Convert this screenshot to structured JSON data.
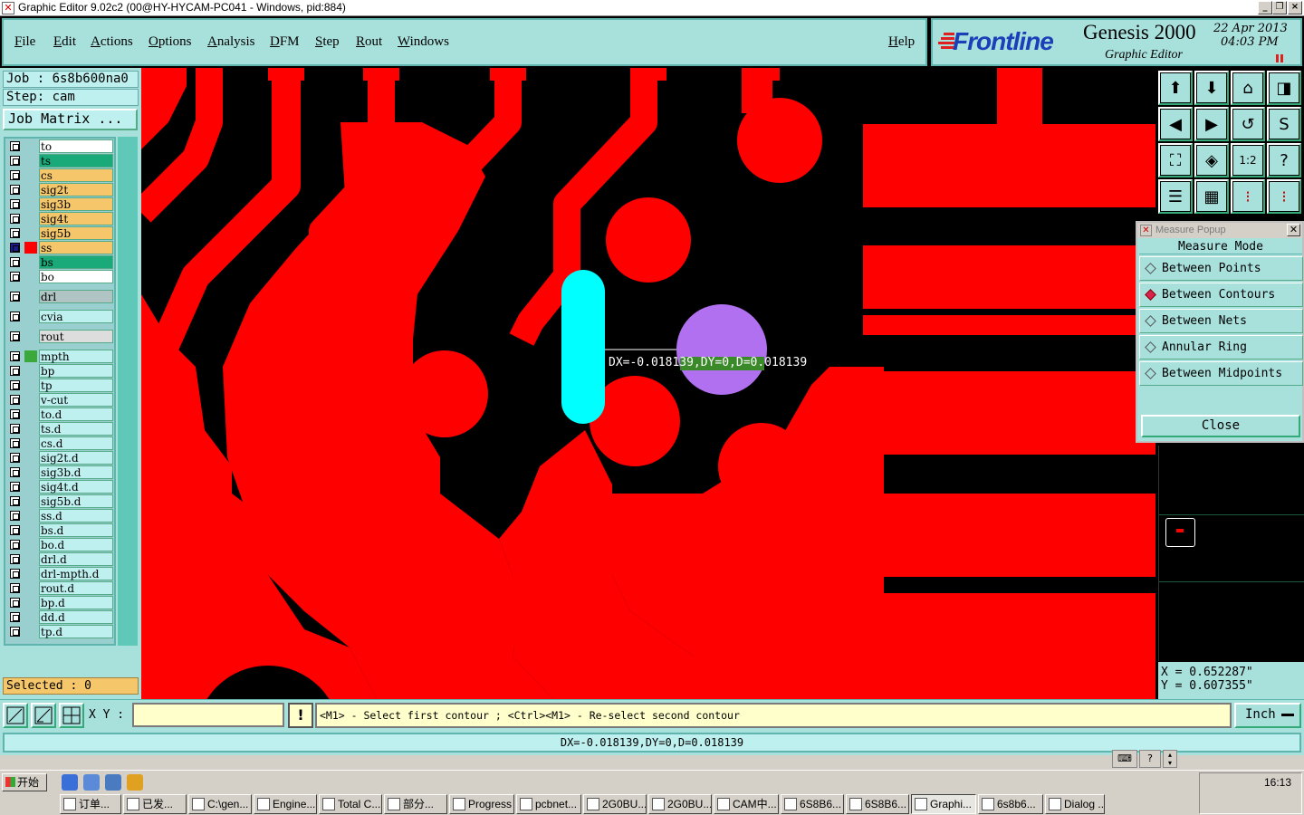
{
  "window": {
    "title": "Graphic Editor 9.02c2 (00@HY-HYCAM-PC041 - Windows, pid:884)"
  },
  "menu": [
    "File",
    "Edit",
    "Actions",
    "Options",
    "Analysis",
    "DFM",
    "Step",
    "Rout",
    "Windows"
  ],
  "help_label": "Help",
  "brand": {
    "logo": "Frontline",
    "product": "Genesis 2000",
    "subtitle": "Graphic Editor",
    "date_line1": "22 Apr 2013",
    "date_line2": "04:03 PM"
  },
  "job": {
    "job_text": "Job : 6s8b600na0",
    "step_text": "Step: cam",
    "matrix_label": "Job Matrix ..."
  },
  "layers": [
    {
      "name": "to",
      "color": "#ffffff",
      "swatch": ""
    },
    {
      "name": "ts",
      "color": "#1aaa7a",
      "swatch": ""
    },
    {
      "name": "cs",
      "color": "#f5c76a",
      "swatch": ""
    },
    {
      "name": "sig2t",
      "color": "#f5c76a",
      "swatch": ""
    },
    {
      "name": "sig3b",
      "color": "#f5c76a",
      "swatch": ""
    },
    {
      "name": "sig4t",
      "color": "#f5c76a",
      "swatch": ""
    },
    {
      "name": "sig5b",
      "color": "#f5c76a",
      "swatch": ""
    },
    {
      "name": "ss",
      "color": "#f5c76a",
      "swatch": "#ff0000"
    },
    {
      "name": "bs",
      "color": "#1aaa7a",
      "swatch": ""
    },
    {
      "name": "bo",
      "color": "#ffffff",
      "swatch": ""
    },
    {
      "name": "drl",
      "color": "#b0c4c4",
      "swatch": ""
    },
    {
      "name": "cvia",
      "color": "#bdf0ee",
      "swatch": ""
    },
    {
      "name": "rout",
      "color": "#dddddd",
      "swatch": ""
    },
    {
      "name": "mpth",
      "color": "#bdf0ee",
      "swatch": "#3aa83a"
    },
    {
      "name": "bp",
      "color": "#bdf0ee",
      "swatch": ""
    },
    {
      "name": "tp",
      "color": "#bdf0ee",
      "swatch": ""
    },
    {
      "name": "v-cut",
      "color": "#bdf0ee",
      "swatch": ""
    },
    {
      "name": "to.d",
      "color": "#bdf0ee",
      "swatch": ""
    },
    {
      "name": "ts.d",
      "color": "#bdf0ee",
      "swatch": ""
    },
    {
      "name": "cs.d",
      "color": "#bdf0ee",
      "swatch": ""
    },
    {
      "name": "sig2t.d",
      "color": "#bdf0ee",
      "swatch": ""
    },
    {
      "name": "sig3b.d",
      "color": "#bdf0ee",
      "swatch": ""
    },
    {
      "name": "sig4t.d",
      "color": "#bdf0ee",
      "swatch": ""
    },
    {
      "name": "sig5b.d",
      "color": "#bdf0ee",
      "swatch": ""
    },
    {
      "name": "ss.d",
      "color": "#bdf0ee",
      "swatch": ""
    },
    {
      "name": "bs.d",
      "color": "#bdf0ee",
      "swatch": ""
    },
    {
      "name": "bo.d",
      "color": "#bdf0ee",
      "swatch": ""
    },
    {
      "name": "drl.d",
      "color": "#bdf0ee",
      "swatch": ""
    },
    {
      "name": "drl-mpth.d",
      "color": "#bdf0ee",
      "swatch": ""
    },
    {
      "name": "rout.d",
      "color": "#bdf0ee",
      "swatch": ""
    },
    {
      "name": "bp.d",
      "color": "#bdf0ee",
      "swatch": ""
    },
    {
      "name": "dd.d",
      "color": "#bdf0ee",
      "swatch": ""
    },
    {
      "name": "tp.d",
      "color": "#bdf0ee",
      "swatch": ""
    }
  ],
  "selected_text": "Selected : 0",
  "canvas": {
    "measure_label": "DX=-0.018139,DY=0,D=0.018139",
    "copper_color": "#ff0000",
    "feature_cyan": "#00ffff",
    "feature_purple": "#b070f0"
  },
  "measure_popup": {
    "title": "Measure Popup",
    "heading": "Measure Mode",
    "options": [
      {
        "label": "Between Points",
        "selected": false
      },
      {
        "label": "Between Contours",
        "selected": true
      },
      {
        "label": "Between Nets",
        "selected": false
      },
      {
        "label": "Annular Ring",
        "selected": false
      },
      {
        "label": "Between Midpoints",
        "selected": false
      }
    ],
    "close_label": "Close"
  },
  "coords": {
    "x_text": "X = 0.652287\"",
    "y_text": "Y = 0.607355\""
  },
  "command": {
    "xy_label": "X Y :",
    "xy_value": "",
    "prompt": "<M1> - Select first contour ; <Ctrl><M1> - Re-select second contour",
    "unit": "Inch"
  },
  "status": "DX=-0.018139,DY=0,D=0.018139",
  "taskbar": {
    "start_label": "开始",
    "clock": "16:13",
    "tasks": [
      "订单...",
      "已发...",
      "C:\\gen...",
      "Engine...",
      "Total C...",
      "部分...",
      "Progress",
      "pcbnet...",
      "2G0BU...",
      "2G0BU...",
      "CAM中...",
      "6S8B6...",
      "6S8B6...",
      "Graphi...",
      "6s8b6...",
      "Dialog ..."
    ],
    "active_task": "Graphi..."
  }
}
